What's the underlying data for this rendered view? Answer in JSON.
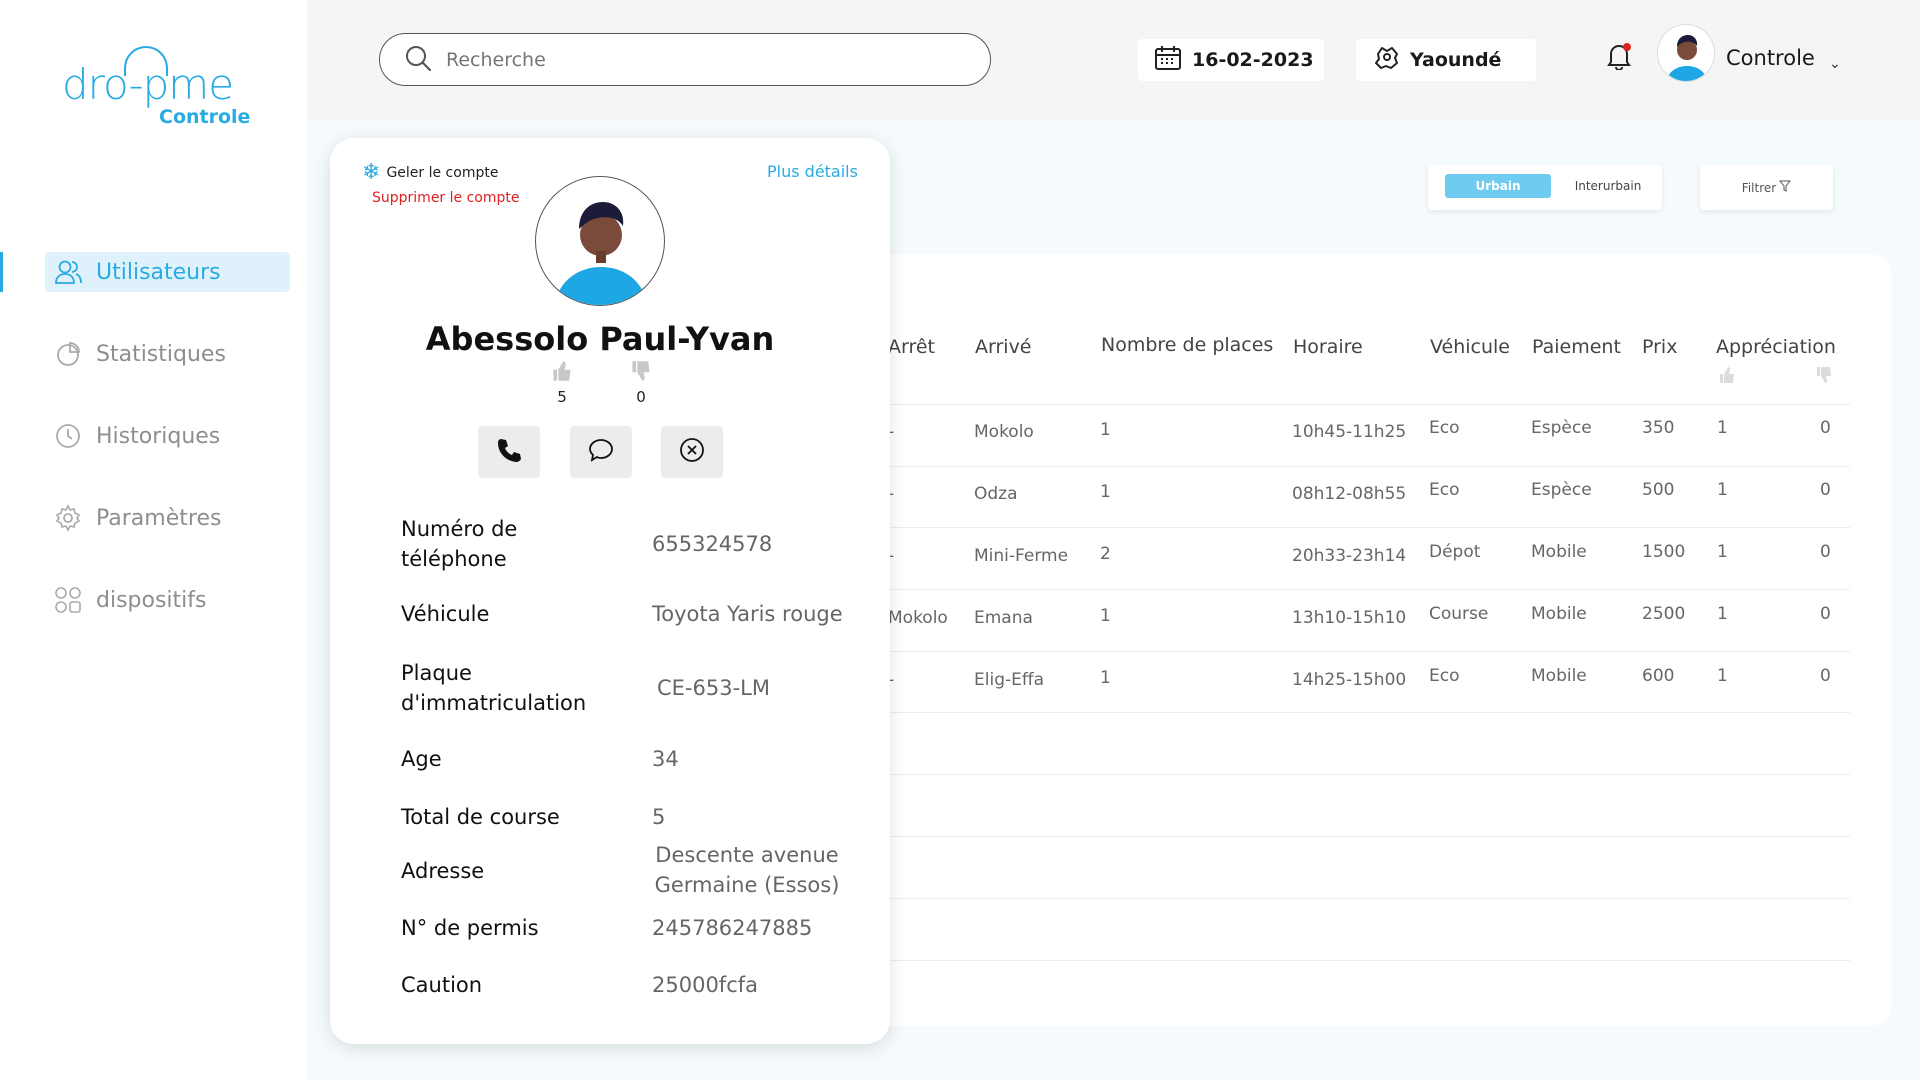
{
  "brand": {
    "logo_text": "dro-pme",
    "logo_sub": "Controle",
    "accent": "#29abe2"
  },
  "sidebar": {
    "items": [
      {
        "label": "Utilisateurs",
        "icon": "users-icon",
        "active": true
      },
      {
        "label": "Statistiques",
        "icon": "pie-chart-icon"
      },
      {
        "label": "Historiques",
        "icon": "clock-icon"
      },
      {
        "label": "Paramètres",
        "icon": "gear-icon"
      },
      {
        "label": "dispositifs",
        "icon": "grid-icon"
      }
    ]
  },
  "header": {
    "search_placeholder": "Recherche",
    "date": "16-02-2023",
    "city": "Yaoundé",
    "user": "Controle"
  },
  "filters": {
    "toggle_on": "Urbain",
    "toggle_off": "Interurbain",
    "filter_label": "Filtrer"
  },
  "table": {
    "headers": [
      "Arrêt",
      "Arrivé",
      "Nombre de places",
      "Horaire",
      "Véhicule",
      "Paiement",
      "Prix",
      "Appréciation"
    ],
    "rows": [
      {
        "arret": "-",
        "arrive": "Mokolo",
        "places": "1",
        "horaire": "10h45-11h25",
        "vehicule": "Eco",
        "paiement": "Espèce",
        "prix": "350",
        "up": "1",
        "down": "0"
      },
      {
        "arret": "-",
        "arrive": "Odza",
        "places": "1",
        "horaire": "08h12-08h55",
        "vehicule": "Eco",
        "paiement": "Espèce",
        "prix": "500",
        "up": "1",
        "down": "0"
      },
      {
        "arret": "-",
        "arrive": "Mini-Ferme",
        "places": "2",
        "horaire": "20h33-23h14",
        "vehicule": "Dépot",
        "paiement": "Mobile",
        "prix": "1500",
        "up": "1",
        "down": "0"
      },
      {
        "arret": "Mokolo",
        "arrive": "Emana",
        "places": "1",
        "horaire": "13h10-15h10",
        "vehicule": "Course",
        "paiement": "Mobile",
        "prix": "2500",
        "up": "1",
        "down": "0"
      },
      {
        "arret": "-",
        "arrive": "Elig-Effa",
        "places": "1",
        "horaire": "14h25-15h00",
        "vehicule": "Eco",
        "paiement": "Mobile",
        "prix": "600",
        "up": "1",
        "down": "0"
      }
    ]
  },
  "profile": {
    "freeze_label": "Geler le compte",
    "delete_label": "Supprimer le compte",
    "details_label": "Plus détails",
    "name": "Abessolo Paul-Yvan",
    "likes": "5",
    "dislikes": "0",
    "fields": [
      {
        "label": "Numéro de téléphone",
        "value": "655324578"
      },
      {
        "label": "Véhicule",
        "value": "Toyota Yaris rouge"
      },
      {
        "label": "Plaque d'immatriculation",
        "value": "CE-653-LM"
      },
      {
        "label": "Age",
        "value": "34"
      },
      {
        "label": "Total de course",
        "value": "5"
      },
      {
        "label": "Adresse",
        "value": "Descente avenue Germaine (Essos)"
      },
      {
        "label": "N° de permis",
        "value": "245786247885"
      },
      {
        "label": "Caution",
        "value": "25000fcfa"
      }
    ]
  }
}
